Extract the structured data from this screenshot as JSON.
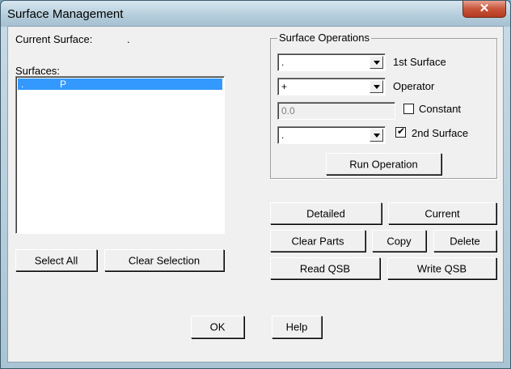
{
  "window": {
    "title": "Surface Management",
    "close_label": "✕"
  },
  "current_surface": {
    "label": "Current Surface:",
    "value": "."
  },
  "surfaces": {
    "label": "Surfaces:",
    "items": [
      {
        "name": ".",
        "flag": "P",
        "selected": true
      }
    ]
  },
  "left_buttons": {
    "select_all": "Select All",
    "clear_selection": "Clear Selection"
  },
  "ops": {
    "group_title": "Surface Operations",
    "first_surface": {
      "value": ".",
      "label": "1st Surface"
    },
    "operator": {
      "value": "+",
      "label": "Operator"
    },
    "constant": {
      "value": "0.0",
      "label": "Constant",
      "checked": false
    },
    "second_surface": {
      "value": ".",
      "label": "2nd Surface",
      "checked": true,
      "check_glyph": "✔"
    },
    "run_label": "Run Operation"
  },
  "right_buttons": {
    "detailed": "Detailed",
    "current": "Current",
    "clear_parts": "Clear Parts",
    "copy": "Copy",
    "delete": "Delete",
    "read_qsb": "Read QSB",
    "write_qsb": "Write QSB"
  },
  "bottom": {
    "ok": "OK",
    "help": "Help"
  },
  "colors": {
    "selection": "#3399ff",
    "dialog_bg": "#f0f0f0",
    "close_red": "#c8543a"
  }
}
